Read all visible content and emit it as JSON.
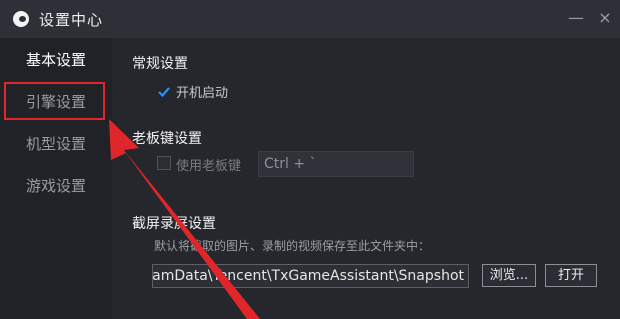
{
  "window": {
    "title": "设置中心",
    "minimize_glyph": "—",
    "close_glyph": "×"
  },
  "sidebar": {
    "items": [
      {
        "label": "基本设置",
        "active": true
      },
      {
        "label": "引擎设置",
        "active": false,
        "highlighted": true
      },
      {
        "label": "机型设置",
        "active": false
      },
      {
        "label": "游戏设置",
        "active": false
      }
    ]
  },
  "general": {
    "title": "常规设置",
    "autostart_label": "开机启动",
    "autostart_checked": true
  },
  "bosskey": {
    "title": "老板键设置",
    "enable_label": "使用老板键",
    "enable_checked": false,
    "hotkey_value": "Ctrl + `"
  },
  "capture": {
    "title": "截屏录屏设置",
    "hint": "默认将截取的图片、录制的视频保存至此文件夹中：",
    "path_value": "C:\\ProgramData\\Tencent\\TxGameAssistant\\Snapshot",
    "browse_label": "浏览...",
    "open_label": "打开"
  },
  "annotation": {
    "highlight_color": "#e0262a",
    "arrow_color": "#e0262a"
  },
  "colors": {
    "checkmark": "#2f8df5",
    "accent_red": "#e0262a"
  }
}
